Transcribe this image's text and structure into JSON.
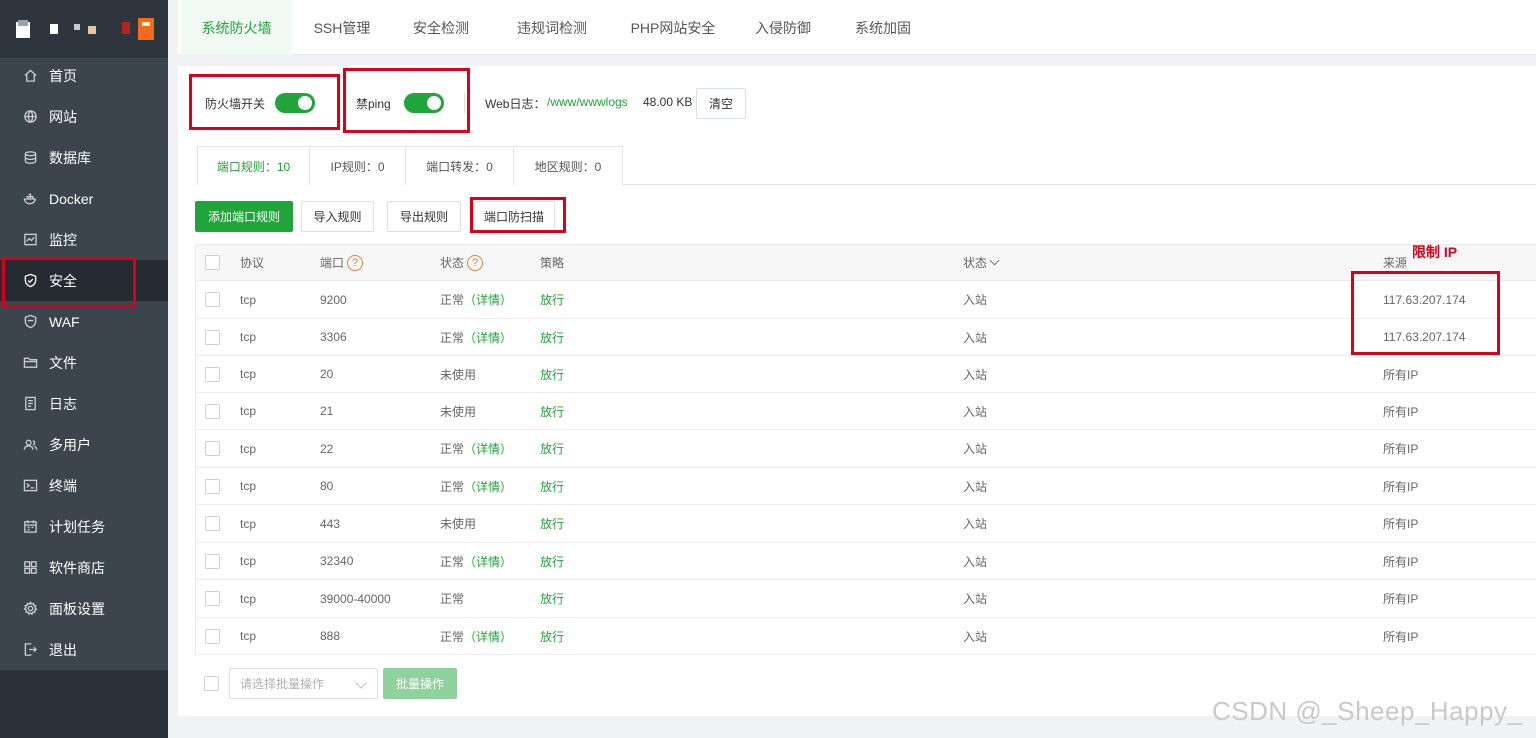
{
  "sidebar": {
    "items": [
      {
        "label": "首页",
        "icon": "home-icon"
      },
      {
        "label": "网站",
        "icon": "globe-icon"
      },
      {
        "label": "数据库",
        "icon": "database-icon"
      },
      {
        "label": "Docker",
        "icon": "docker-icon"
      },
      {
        "label": "监控",
        "icon": "monitor-icon"
      },
      {
        "label": "安全",
        "icon": "shield-icon",
        "active": true
      },
      {
        "label": "WAF",
        "icon": "waf-icon"
      },
      {
        "label": "文件",
        "icon": "folder-icon"
      },
      {
        "label": "日志",
        "icon": "log-icon"
      },
      {
        "label": "多用户",
        "icon": "users-icon"
      },
      {
        "label": "终端",
        "icon": "terminal-icon"
      },
      {
        "label": "计划任务",
        "icon": "calendar-icon"
      },
      {
        "label": "软件商店",
        "icon": "apps-icon"
      },
      {
        "label": "面板设置",
        "icon": "gear-icon"
      },
      {
        "label": "退出",
        "icon": "logout-icon"
      }
    ]
  },
  "tabs": [
    {
      "label": "系统防火墙",
      "active": true
    },
    {
      "label": "SSH管理"
    },
    {
      "label": "安全检测"
    },
    {
      "label": "违规词检测"
    },
    {
      "label": "PHP网站安全"
    },
    {
      "label": "入侵防御"
    },
    {
      "label": "系统加固"
    }
  ],
  "controls": {
    "firewall_label": "防火墙开关",
    "firewall_on": true,
    "ping_label": "禁ping",
    "ping_on": true,
    "weblog_label": "Web日志：",
    "weblog_path": "/www/wwwlogs",
    "weblog_size": "48.00 KB",
    "clear_button": "清空"
  },
  "subtabs": [
    {
      "label": "端口规则：10",
      "active": true
    },
    {
      "label": "IP规则：0"
    },
    {
      "label": "端口转发：0"
    },
    {
      "label": "地区规则：0"
    }
  ],
  "actions": {
    "add": "添加端口规则",
    "import": "导入规则",
    "export": "导出规则",
    "scan": "端口防扫描"
  },
  "table": {
    "headers": {
      "protocol": "协议",
      "port": "端口",
      "status": "状态",
      "strategy": "策略",
      "direction": "状态",
      "source": "来源"
    },
    "rows": [
      {
        "protocol": "tcp",
        "port": "9200",
        "status": "正常",
        "detail": "（详情）",
        "strategy": "放行",
        "direction": "入站",
        "source": "117.63.207.174"
      },
      {
        "protocol": "tcp",
        "port": "3306",
        "status": "正常",
        "detail": "（详情）",
        "strategy": "放行",
        "direction": "入站",
        "source": "117.63.207.174"
      },
      {
        "protocol": "tcp",
        "port": "20",
        "status": "未使用",
        "detail": "",
        "strategy": "放行",
        "direction": "入站",
        "source": "所有IP"
      },
      {
        "protocol": "tcp",
        "port": "21",
        "status": "未使用",
        "detail": "",
        "strategy": "放行",
        "direction": "入站",
        "source": "所有IP"
      },
      {
        "protocol": "tcp",
        "port": "22",
        "status": "正常",
        "detail": "（详情）",
        "strategy": "放行",
        "direction": "入站",
        "source": "所有IP"
      },
      {
        "protocol": "tcp",
        "port": "80",
        "status": "正常",
        "detail": "（详情）",
        "strategy": "放行",
        "direction": "入站",
        "source": "所有IP"
      },
      {
        "protocol": "tcp",
        "port": "443",
        "status": "未使用",
        "detail": "",
        "strategy": "放行",
        "direction": "入站",
        "source": "所有IP"
      },
      {
        "protocol": "tcp",
        "port": "32340",
        "status": "正常",
        "detail": "（详情）",
        "strategy": "放行",
        "direction": "入站",
        "source": "所有IP"
      },
      {
        "protocol": "tcp",
        "port": "39000-40000",
        "status": "正常",
        "detail": "",
        "strategy": "放行",
        "direction": "入站",
        "source": "所有IP"
      },
      {
        "protocol": "tcp",
        "port": "888",
        "status": "正常",
        "detail": "（详情）",
        "strategy": "放行",
        "direction": "入站",
        "source": "所有IP"
      }
    ]
  },
  "batch": {
    "placeholder": "请选择批量操作",
    "button": "批量操作"
  },
  "annotation": "限制 IP",
  "watermark": "CSDN @_Sheep_Happy_",
  "colors": {
    "accent": "#20a53a",
    "annotation": "#d9001b",
    "sidebar": "#3c444d"
  }
}
